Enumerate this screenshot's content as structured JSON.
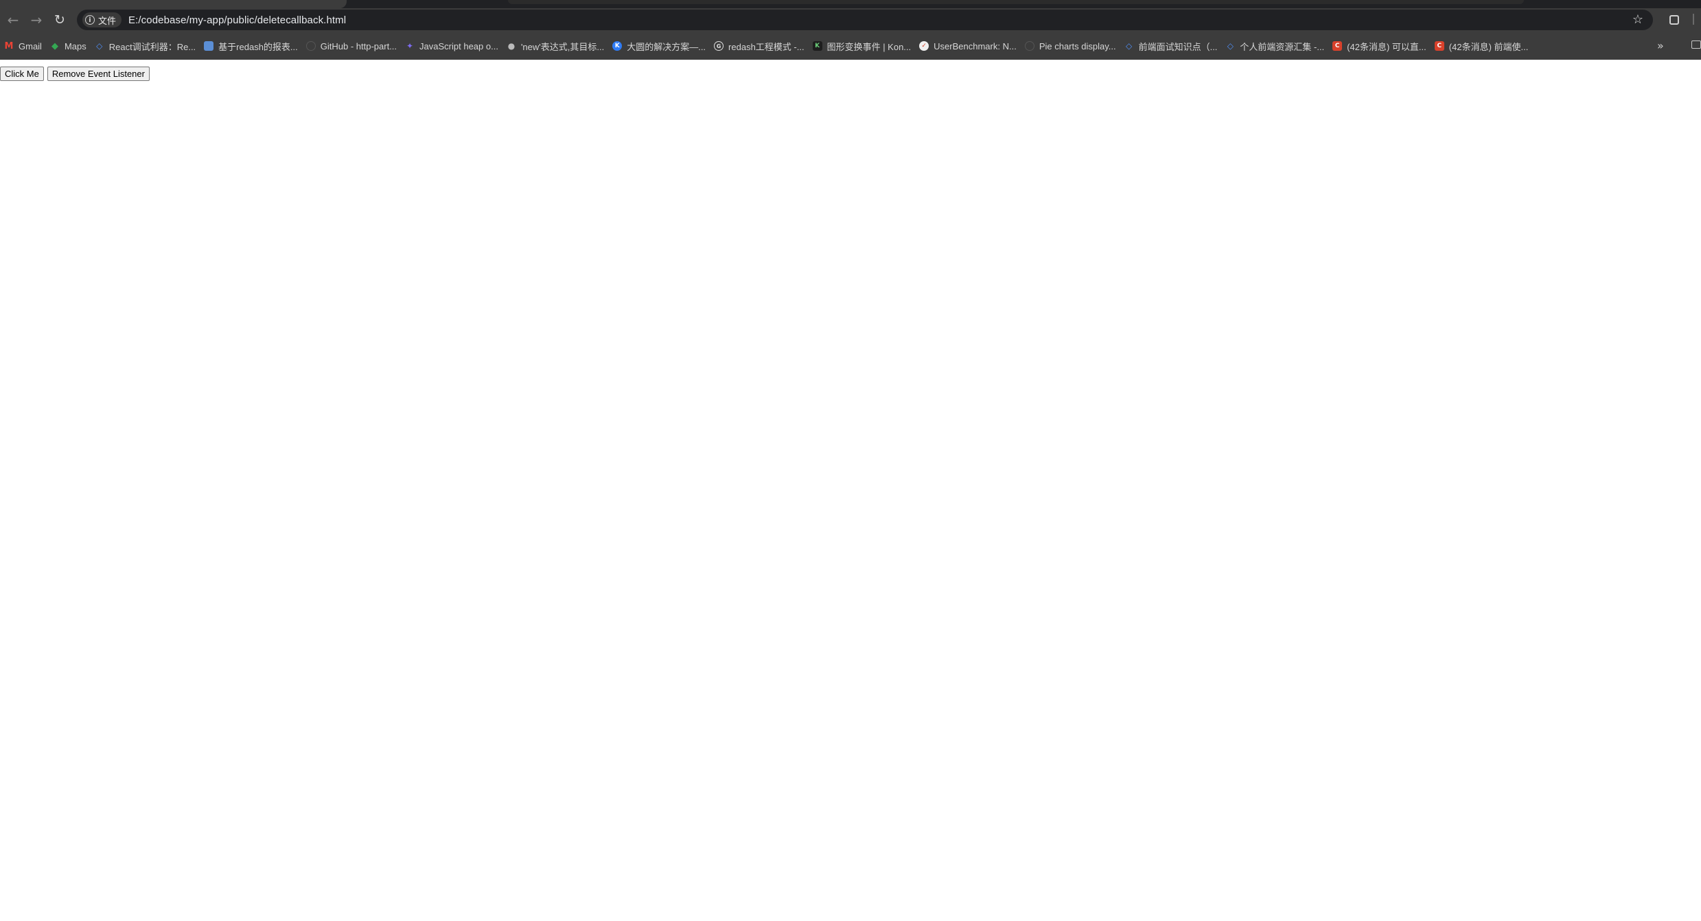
{
  "browser": {
    "url_chip_label": "文件",
    "url": "E:/codebase/my-app/public/deletecallback.html",
    "nav_icons": {
      "back": "arrow-left-icon",
      "forward": "arrow-right-icon",
      "reload": "reload-icon"
    }
  },
  "bookmarks": [
    {
      "label": "Gmail",
      "icon": "gmail-icon"
    },
    {
      "label": "Maps",
      "icon": "maps-icon"
    },
    {
      "label": "React调试利器：Re...",
      "icon": "juejin-icon"
    },
    {
      "label": "基于redash的报表...",
      "icon": "doc-icon"
    },
    {
      "label": "GitHub - http-part...",
      "icon": "github-icon"
    },
    {
      "label": "JavaScript heap o...",
      "icon": "js-heap-icon"
    },
    {
      "label": "'new'表达式,其目标...",
      "icon": "wechat-icon"
    },
    {
      "label": "大圆的解决方案—...",
      "icon": "k-icon"
    },
    {
      "label": "redash工程模式 -...",
      "icon": "google-icon"
    },
    {
      "label": "图形变换事件 | Kon...",
      "icon": "konva-icon"
    },
    {
      "label": "UserBenchmark: N...",
      "icon": "userbenchmark-icon"
    },
    {
      "label": "Pie charts display...",
      "icon": "github-icon"
    },
    {
      "label": "前端面试知识点（...",
      "icon": "juejin-icon"
    },
    {
      "label": "个人前端资源汇集 -...",
      "icon": "juejin-icon"
    },
    {
      "label": "(42条消息) 可以直...",
      "icon": "csdn-icon"
    },
    {
      "label": "(42条消息) 前端使...",
      "icon": "csdn-icon"
    }
  ],
  "page": {
    "click_button_label": "Click Me",
    "remove_button_label": "Remove Event Listener"
  }
}
